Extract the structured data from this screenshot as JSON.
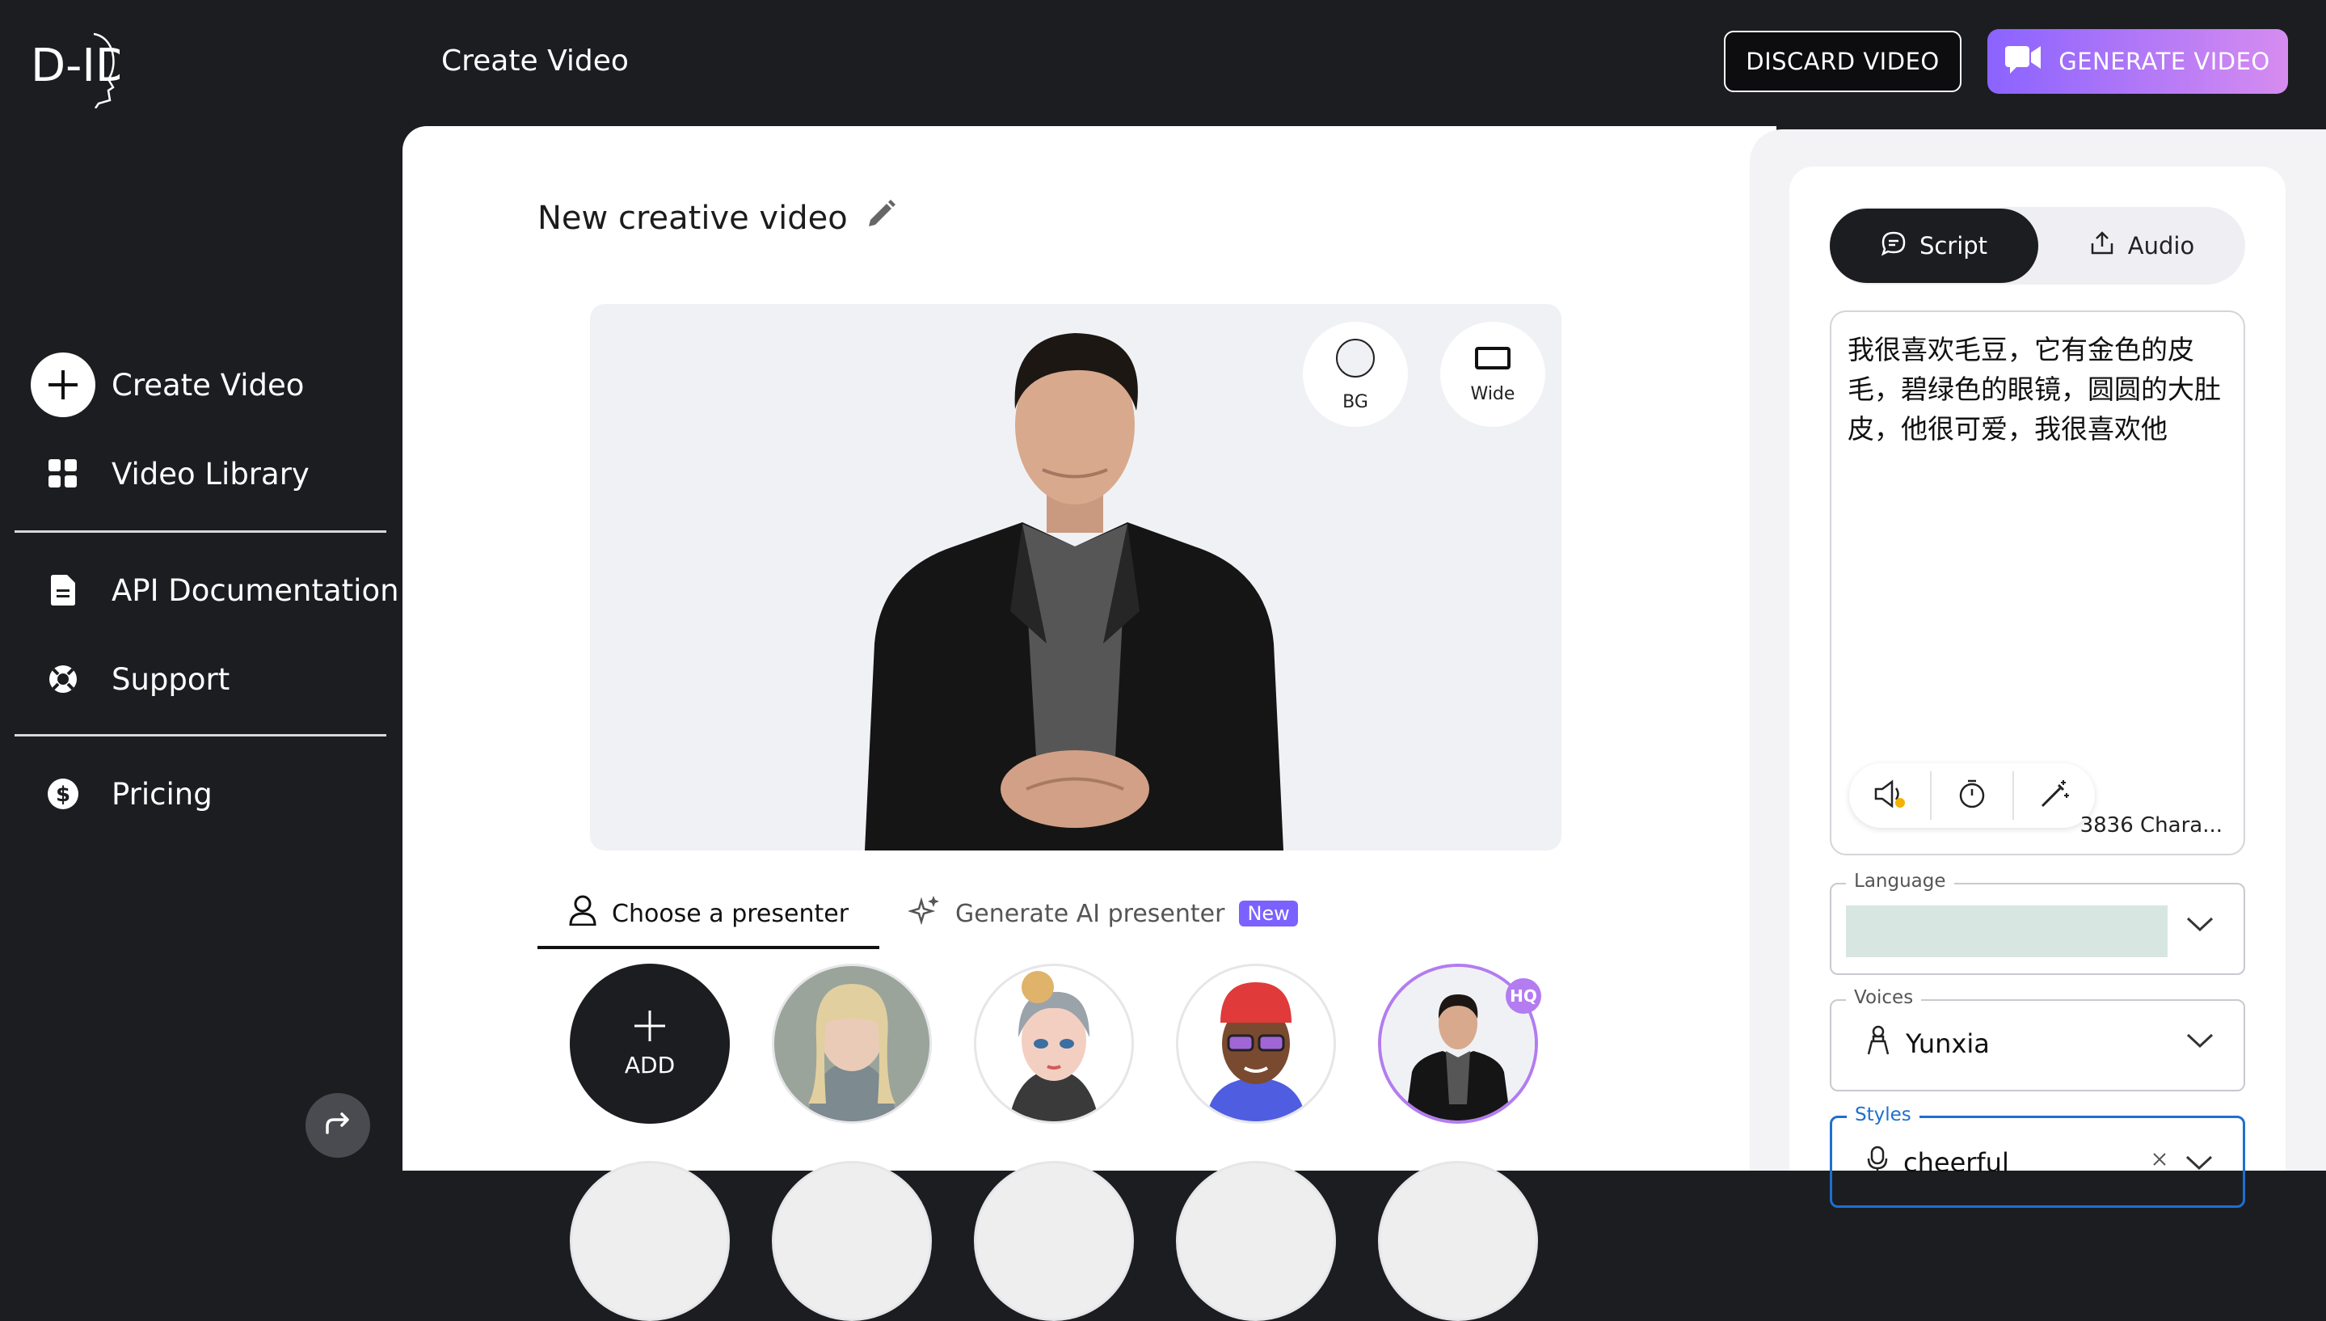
{
  "header": {
    "logo_text": "D-ID",
    "title": "Create Video",
    "discard_label": "DISCARD VIDEO",
    "generate_label": "GENERATE VIDEO"
  },
  "sidebar": {
    "items": [
      {
        "label": "Create Video",
        "icon": "plus-icon"
      },
      {
        "label": "Video Library",
        "icon": "grid-icon"
      },
      {
        "label": "API Documentation",
        "icon": "document-icon"
      },
      {
        "label": "Support",
        "icon": "lifebuoy-icon"
      },
      {
        "label": "Pricing",
        "icon": "dollar-icon"
      }
    ]
  },
  "editor": {
    "video_title": "New creative video",
    "stage_buttons": {
      "bg": "BG",
      "wide": "Wide"
    },
    "tabs": {
      "choose": "Choose a presenter",
      "generate": "Generate AI presenter",
      "new_badge": "New"
    },
    "presenters": {
      "add_label": "ADD",
      "hq_badge": "HQ"
    }
  },
  "panel": {
    "tab_script": "Script",
    "tab_audio": "Audio",
    "script_text": "我很喜欢毛豆，它有金色的皮毛，碧绿色的眼镜，圆圆的大肚皮，他很可爱，我很喜欢他",
    "char_count": "3836 Chara...",
    "language_label": "Language",
    "voices_label": "Voices",
    "voice_value": "Yunxia",
    "styles_label": "Styles",
    "style_value": "cheerful"
  },
  "colors": {
    "accent": "#7b61ff",
    "generate_gradient_start": "#8a63ff",
    "generate_gradient_end": "#d68cf0",
    "focus_blue": "#1e6fd0",
    "dark_bg": "#1c1d21"
  }
}
